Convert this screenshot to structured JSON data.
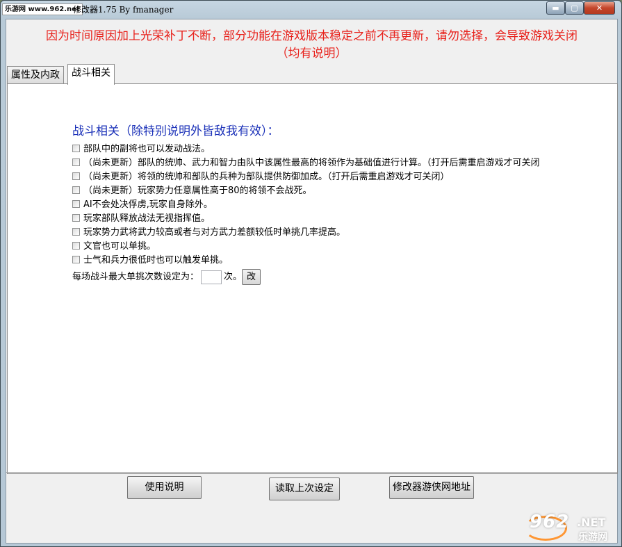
{
  "window": {
    "site_label": "乐游网 www.962.net",
    "title": "修改器1.75 By fmanager",
    "minimize": "▬",
    "maximize": "▢",
    "close": "✕"
  },
  "warning": {
    "line1": "因为时间原因加上光荣补丁不断，部分功能在游戏版本稳定之前不再更新，请勿选择，会导致游戏关闭",
    "line2": "（均有说明）"
  },
  "tabs": [
    {
      "label": "属性及内政",
      "active": false
    },
    {
      "label": "战斗相关",
      "active": true
    }
  ],
  "battle": {
    "section_title": "战斗相关（除特别说明外皆敌我有效）：",
    "options": [
      {
        "label": "部队中的副将也可以发动战法。",
        "checked": false
      },
      {
        "label": "（尚未更新）部队的统帅、武力和智力由队中该属性最高的将领作为基础值进行计算。（打开后需重启游戏才可关闭",
        "checked": false
      },
      {
        "label": "（尚未更新）将领的统帅和部队的兵种为部队提供防御加成。（打开后需重启游戏才可关闭）",
        "checked": false
      },
      {
        "label": "（尚未更新）玩家势力任意属性高于80的将领不会战死。",
        "checked": false
      },
      {
        "label": "AI不会处决俘虏,玩家自身除外。",
        "checked": false
      },
      {
        "label": "玩家部队释放战法无视指挥值。",
        "checked": false
      },
      {
        "label": "玩家势力武将武力较高或者与对方武力差额较低时单挑几率提高。",
        "checked": false
      },
      {
        "label": "文官也可以单挑。",
        "checked": false
      },
      {
        "label": "士气和兵力很低时也可以触发单挑。",
        "checked": false
      }
    ],
    "duel_count_prefix": "每场战斗最大单挑次数设定为：",
    "duel_count_value": "",
    "duel_count_suffix": "次。",
    "change_button": "改"
  },
  "footer": {
    "help_button": "使用说明",
    "load_button": "读取上次设定",
    "url_button": "修改器游侠网地址"
  },
  "watermark": {
    "number": "962",
    "net": ".NET",
    "cn": "乐游网"
  }
}
